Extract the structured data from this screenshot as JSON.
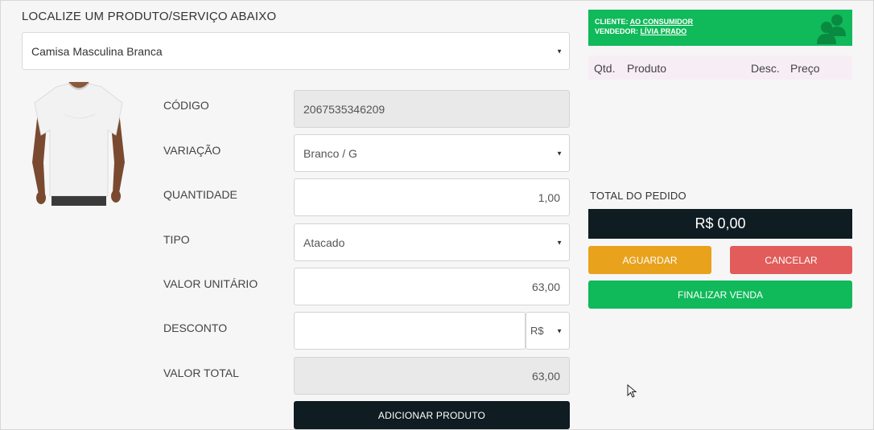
{
  "header": {
    "title": "LOCALIZE UM PRODUTO/SERVIÇO ABAIXO"
  },
  "product_search": {
    "value": "Camisa Masculina Branca"
  },
  "form": {
    "codigo": {
      "label": "CÓDIGO",
      "value": "2067535346209"
    },
    "variacao": {
      "label": "VARIAÇÃO",
      "value": "Branco / G"
    },
    "quantidade": {
      "label": "QUANTIDADE",
      "value": "1,00"
    },
    "tipo": {
      "label": "TIPO",
      "value": "Atacado"
    },
    "valor_unitario": {
      "label": "VALOR UNITÁRIO",
      "value": "63,00"
    },
    "desconto": {
      "label": "DESCONTO",
      "value": "",
      "currency": "R$"
    },
    "valor_total": {
      "label": "VALOR TOTAL",
      "value": "63,00"
    },
    "add_button": "ADICIONAR PRODUTO"
  },
  "order": {
    "cliente_label": "CLIENTE:",
    "cliente_value": "AO CONSUMIDOR",
    "vendedor_label": "VENDEDOR:",
    "vendedor_value": "LÍVIA PRADO",
    "columns": {
      "qtd": "Qtd.",
      "produto": "Produto",
      "desc": "Desc.",
      "preco": "Preço"
    },
    "total_label": "TOTAL DO PEDIDO",
    "total_value": "R$ 0,00",
    "wait_button": "AGUARDAR",
    "cancel_button": "CANCELAR",
    "finish_button": "FINALIZAR VENDA"
  },
  "colors": {
    "green": "#10b95a",
    "dark": "#0f1c22",
    "orange": "#e8a21c",
    "red": "#e15c5a"
  },
  "icons": [
    "users-icon",
    "tshirt-image",
    "caret-down-icon",
    "mouse-pointer-icon"
  ]
}
